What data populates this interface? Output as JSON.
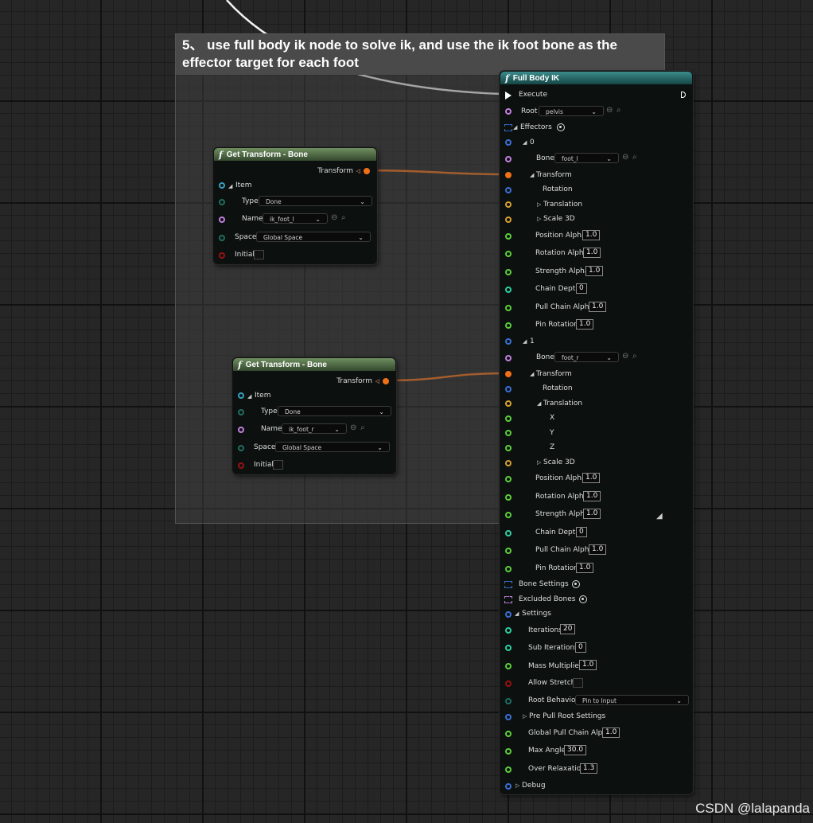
{
  "comment": {
    "title": "5、 use full body ik node to solve ik, and use the ik foot bone as the effector target for each foot"
  },
  "get_transform_1": {
    "title": "Get Transform - Bone",
    "output": "Transform",
    "item": "Item",
    "type_label": "Type",
    "type_value": "Done",
    "name_label": "Name",
    "name_value": "ik_foot_l",
    "space_label": "Space",
    "space_value": "Global Space",
    "initial_label": "Initial"
  },
  "get_transform_2": {
    "title": "Get Transform - Bone",
    "output": "Transform",
    "item": "Item",
    "type_label": "Type",
    "type_value": "Done",
    "name_label": "Name",
    "name_value": "ik_foot_r",
    "space_label": "Space",
    "space_value": "Global Space",
    "initial_label": "Initial"
  },
  "full_body_ik": {
    "title": "Full Body IK",
    "execute": "Execute",
    "root_label": "Root",
    "root_value": "pelvis",
    "effectors": "Effectors",
    "effector_0": {
      "index": "0",
      "bone_label": "Bone",
      "bone_value": "foot_l",
      "transform": "Transform",
      "rotation": "Rotation",
      "translation": "Translation",
      "scale": "Scale 3D",
      "position_alpha_label": "Position Alpha",
      "position_alpha": "1.0",
      "rotation_alpha_label": "Rotation Alpha",
      "rotation_alpha": "1.0",
      "strength_alpha_label": "Strength Alpha",
      "strength_alpha": "1.0",
      "chain_depth_label": "Chain Depth",
      "chain_depth": "0",
      "pull_chain_alpha_label": "Pull Chain Alpha",
      "pull_chain_alpha": "1.0",
      "pin_rotation_label": "Pin Rotation",
      "pin_rotation": "1.0"
    },
    "effector_1": {
      "index": "1",
      "bone_label": "Bone",
      "bone_value": "foot_r",
      "transform": "Transform",
      "rotation": "Rotation",
      "translation": "Translation",
      "x": "X",
      "y": "Y",
      "z": "Z",
      "scale": "Scale 3D",
      "position_alpha_label": "Position Alpha",
      "position_alpha": "1.0",
      "rotation_alpha_label": "Rotation Alpha",
      "rotation_alpha": "1.0",
      "strength_alpha_label": "Strength Alpha",
      "strength_alpha": "1.0",
      "chain_depth_label": "Chain Depth",
      "chain_depth": "0",
      "pull_chain_alpha_label": "Pull Chain Alpha",
      "pull_chain_alpha": "1.0",
      "pin_rotation_label": "Pin Rotation",
      "pin_rotation": "1.0"
    },
    "bone_settings": "Bone Settings",
    "excluded_bones": "Excluded Bones",
    "settings": {
      "label": "Settings",
      "iterations_label": "Iterations",
      "iterations": "20",
      "sub_iterations_label": "Sub Iterations",
      "sub_iterations": "0",
      "mass_multiplier_label": "Mass Multiplier",
      "mass_multiplier": "1.0",
      "allow_stretch_label": "Allow Stretch",
      "root_behavior_label": "Root Behavior",
      "root_behavior": "Pin to Input",
      "pre_pull_root_label": "Pre Pull Root Settings",
      "global_pull_label": "Global Pull Chain Alpha",
      "global_pull": "1.0",
      "max_angle_label": "Max Angle",
      "max_angle": "30.0",
      "over_relaxation_label": "Over Relaxation",
      "over_relaxation": "1.3"
    },
    "debug": "Debug"
  },
  "watermark": "CSDN @lalapanda",
  "colors": {
    "vector_pin": "#3b6fd6",
    "name_pin": "#c47fe0",
    "struct_pin": "#3aa0c0",
    "float_pin": "#5ccf3c",
    "int_pin": "#2fcfa0",
    "bool_pin": "#9b1010",
    "transform_pin": "#f07018",
    "rotator_pin": "#d8a030",
    "enum_pin": "#1f6e60",
    "wire": "#f07018"
  }
}
